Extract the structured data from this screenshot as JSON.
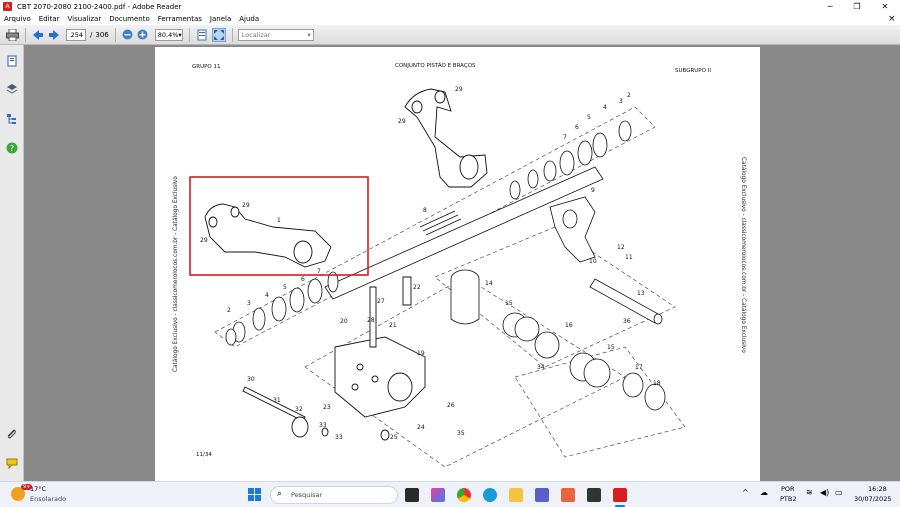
{
  "window": {
    "title": "CBT 2070-2080 2100-2400.pdf - Adobe Reader",
    "controls": [
      "─",
      "❐",
      "✕"
    ]
  },
  "menu": {
    "items": [
      "Arquivo",
      "Editar",
      "Visualizar",
      "Documento",
      "Ferramentas",
      "Janela",
      "Ajuda"
    ],
    "close_glyph": "×"
  },
  "toolbar": {
    "current_page": "254",
    "separator": "/",
    "total_pages": "306",
    "zoom": "80,4%",
    "search_placeholder": "Localizar"
  },
  "document": {
    "header_left": "GRUPO 11",
    "header_center": "CONJUNTO PISTÃO E BRAÇOS",
    "header_right": "SUBGRUPO II",
    "footer_left": "11/34",
    "side_text": "Catálogo Exclusivo - classicomerolocos.com.br - Catálogo Exclusivo",
    "part_numbers": [
      "1",
      "2",
      "3",
      "4",
      "5",
      "6",
      "7",
      "8",
      "9",
      "10",
      "11",
      "12",
      "13",
      "14",
      "15",
      "16",
      "17",
      "18",
      "19",
      "20",
      "21",
      "22",
      "23",
      "24",
      "25",
      "26",
      "27",
      "28",
      "29",
      "30",
      "31",
      "32",
      "33",
      "34",
      "35",
      "36"
    ],
    "labels": {
      "l29a": "29",
      "l29b": "29",
      "l29c": "29",
      "l29d": "29",
      "l1": "1",
      "l8": "8",
      "l9": "9",
      "l2a": "2",
      "l3a": "3",
      "l4a": "4",
      "l5a": "5",
      "l6a": "6",
      "l7a": "7",
      "l2b": "2",
      "l3b": "3",
      "l4b": "4",
      "l5b": "5",
      "l6b": "6",
      "l7b": "7",
      "l10": "10",
      "l11": "11",
      "l12": "12",
      "l13": "13",
      "l14": "14",
      "l15a": "15",
      "l15b": "15",
      "l16": "16",
      "l17": "17",
      "l18": "18",
      "l19": "19",
      "l20": "20",
      "l21": "21",
      "l22": "22",
      "l23": "23",
      "l24": "24",
      "l25": "25",
      "l26": "26",
      "l27": "27",
      "l28": "28",
      "l30": "30",
      "l31": "31",
      "l32": "32",
      "l33a": "33",
      "l33b": "33",
      "l34": "34",
      "l35": "35",
      "l36": "36"
    }
  },
  "taskbar": {
    "weather_temp": "17°C",
    "weather_desc": "Ensolarado",
    "search_placeholder": "Pesquisar",
    "badge": "9+",
    "lang": "POR",
    "kbd": "PTB2",
    "time": "16:28",
    "date": "30/07/2025"
  },
  "colors": {
    "highlight": "#d42020",
    "chrome": "#e9e9e9",
    "doc_bg": "#898989",
    "accent_blue": "#2a6fd0"
  }
}
